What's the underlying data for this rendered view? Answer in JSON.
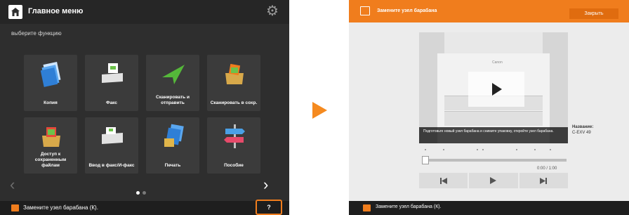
{
  "left_panel": {
    "title": "Главное меню",
    "subtitle": "выберите функцию",
    "tiles": [
      {
        "label": "Копия",
        "icon": "copy-icon"
      },
      {
        "label": "Факс",
        "icon": "fax-icon"
      },
      {
        "label": "Сканировать и отправить",
        "icon": "scan-send-icon"
      },
      {
        "label": "Сканировать в сохр.",
        "icon": "scan-store-icon"
      },
      {
        "label": "Доступ к сохраненным файлам",
        "icon": "stored-files-icon"
      },
      {
        "label": "Ввод в факс/И-факс",
        "icon": "fax-input-icon"
      },
      {
        "label": "Печать",
        "icon": "print-icon"
      },
      {
        "label": "Пособие",
        "icon": "guide-icon"
      }
    ],
    "page_count": 2,
    "current_page": 1,
    "footer_text": "Замените узел барабана (К).",
    "help_label": "?"
  },
  "right_panel": {
    "title": "Замените узел барабана",
    "close_label": "Закрыть",
    "video": {
      "brand": "Canon",
      "caption": "Подготовьте новый узел барабана и снимите упаковку, откройте узел барабана."
    },
    "time": "0:00 / 1:00",
    "progress": 0.0,
    "side_label": "Название:",
    "side_value": "C-EXV 49",
    "footer_text": "Замените узел барабана (К)."
  },
  "colors": {
    "accent": "#f07d1d",
    "dark_bg": "#2e2e2e",
    "tile_bg": "#3b3b3b"
  }
}
